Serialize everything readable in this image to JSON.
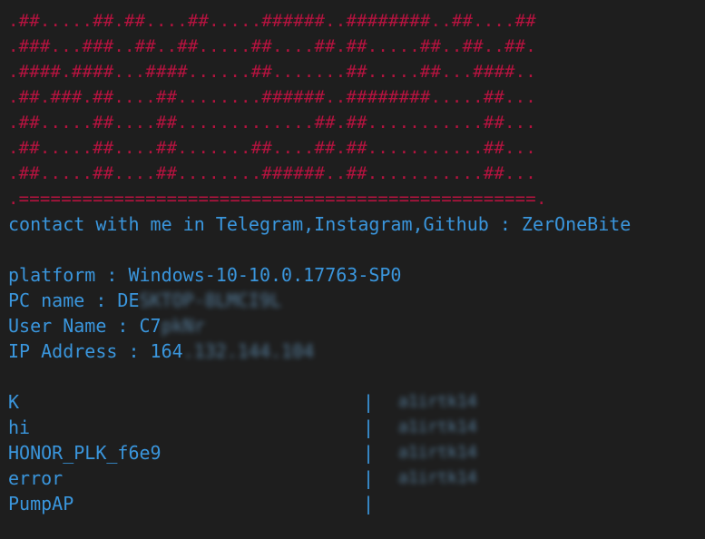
{
  "banner": {
    "lines": [
      ".##.....##.##....##.....######..########..##....##",
      ".###...###..##..##.....##....##.##.....##..##..##.",
      ".####.####...####......##.......##.....##...####..",
      ".##.###.##....##........######..########.....##...",
      ".##.....##....##.............##.##...........##...",
      ".##.....##....##.......##....##.##...........##...",
      ".##.....##....##........######..##...........##...",
      ".=================================================."
    ]
  },
  "contact": "contact with me in Telegram,Instagram,Github : ZerOneBite",
  "info": {
    "platform": "platform : Windows-10-10.0.17763-SP0",
    "pc_name_prefix": "PC name : DE",
    "pc_name_blurred": "SKTOP-8LMCI9L",
    "user_name_prefix": "User Name : C7",
    "user_name_blurred": "pkNr",
    "ip_prefix": "IP Address : 164",
    "ip_blurred": ".132.144.104"
  },
  "wifi": {
    "separator": "|",
    "rows": [
      {
        "ssid": "K",
        "password": "a1irtk14"
      },
      {
        "ssid": "hi",
        "password": "a1irtk14"
      },
      {
        "ssid": "HONOR_PLK_f6e9",
        "password": "a1irtk14"
      },
      {
        "ssid": "error",
        "password": "a1irtk14"
      },
      {
        "ssid": "PumpAP",
        "password": ""
      }
    ]
  },
  "colors": {
    "background": "#1e1e1e",
    "banner": "#b5133f",
    "text": "#3a96dd"
  }
}
